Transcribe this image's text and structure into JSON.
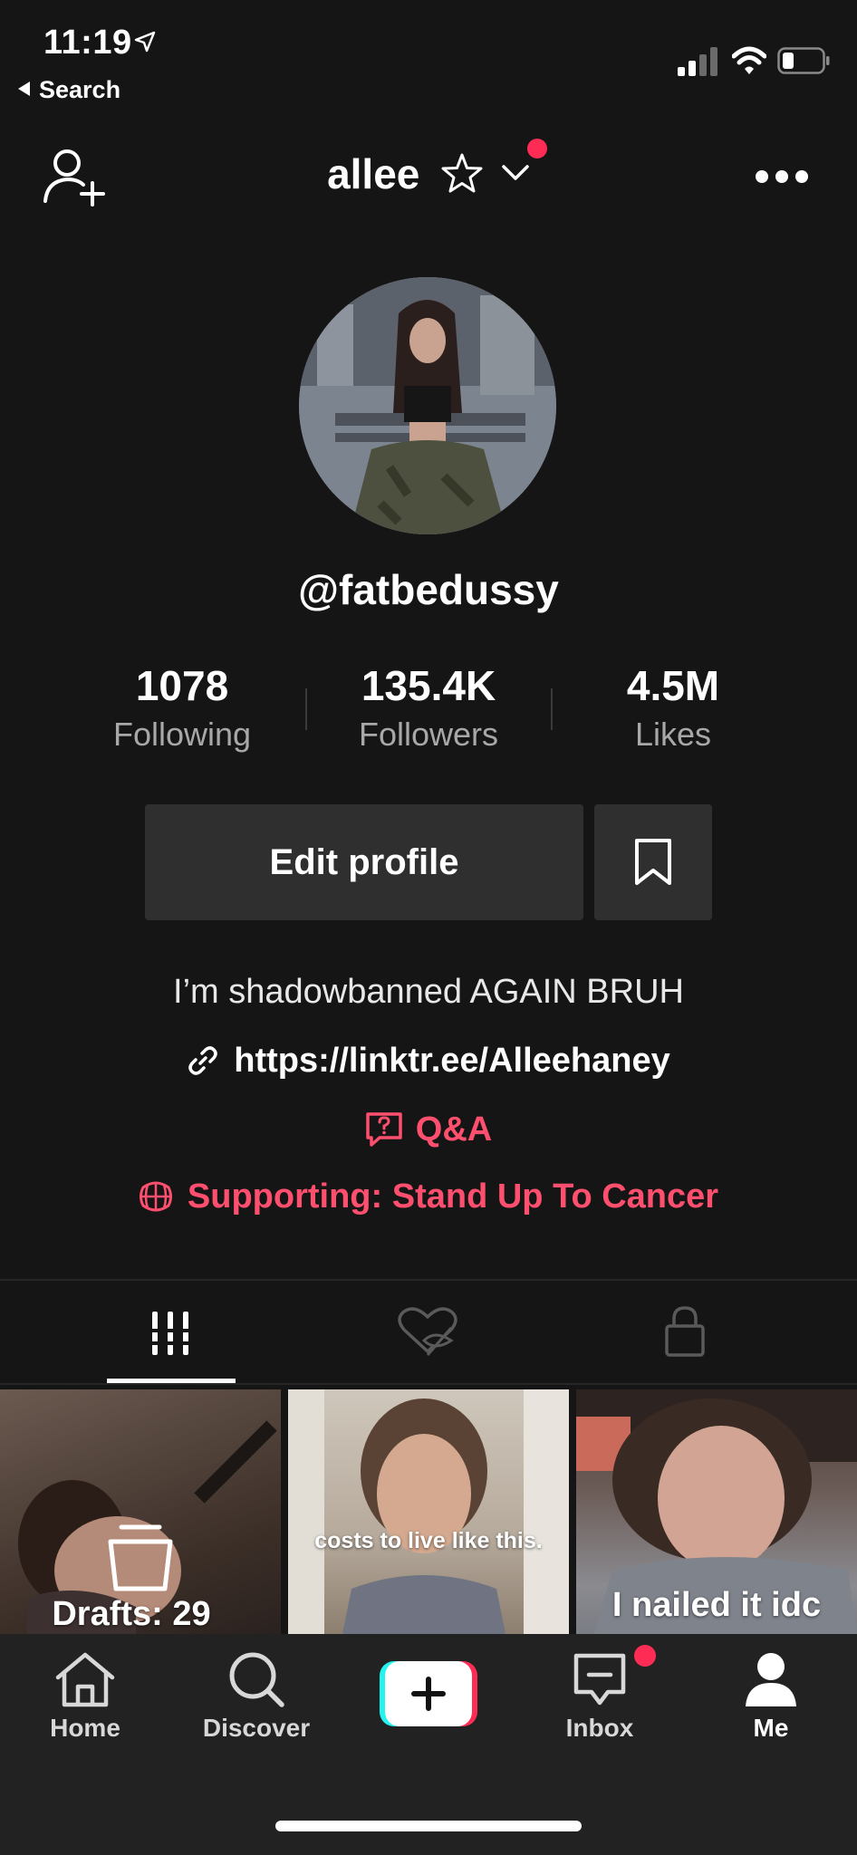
{
  "status_bar": {
    "time": "11:19",
    "back_label": "Search"
  },
  "header": {
    "username": "allee"
  },
  "profile": {
    "handle": "@fatbedussy",
    "stats": [
      {
        "value": "1078",
        "label": "Following"
      },
      {
        "value": "135.4K",
        "label": "Followers"
      },
      {
        "value": "4.5M",
        "label": "Likes"
      }
    ],
    "edit_button": "Edit profile",
    "bio": "I’m shadowbanned AGAIN BRUH",
    "link": "https://linktr.ee/Alleehaney",
    "qa_label": "Q&A",
    "supporting": "Supporting: Stand Up To Cancer"
  },
  "videos": [
    {
      "overlay": "Drafts: 29"
    },
    {
      "overlay": "costs to live like this."
    },
    {
      "overlay": "I nailed it idc"
    }
  ],
  "nav": {
    "items": [
      {
        "label": "Home"
      },
      {
        "label": "Discover"
      },
      {
        "label": ""
      },
      {
        "label": "Inbox"
      },
      {
        "label": "Me"
      }
    ]
  },
  "colors": {
    "accent": "#fe2c55",
    "link_red": "#fe4f6e",
    "background": "#151515",
    "button_bg": "#2f2f2f"
  },
  "icons": [
    "location-arrow-icon",
    "signal-icon",
    "wifi-icon",
    "battery-icon",
    "add-user-icon",
    "star-icon",
    "chevron-down-icon",
    "more-icon",
    "bookmark-icon",
    "link-icon",
    "qa-icon",
    "globe-icon",
    "grid-icon",
    "heart-hidden-icon",
    "lock-icon",
    "trash-icon",
    "home-icon",
    "search-icon",
    "plus-icon",
    "inbox-icon",
    "person-icon"
  ]
}
